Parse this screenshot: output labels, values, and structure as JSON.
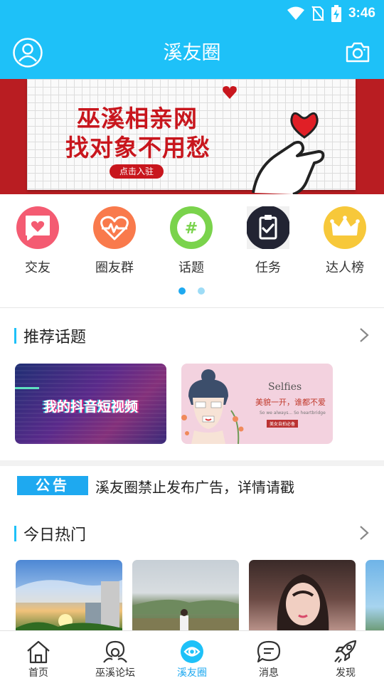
{
  "status_bar": {
    "time": "3:46"
  },
  "header": {
    "title": "溪友圈"
  },
  "banner": {
    "line1": "巫溪相亲网",
    "line2": "找对象不用愁",
    "cta": "点击入驻"
  },
  "quick_menu": [
    {
      "label": "交友",
      "icon": "heart-chat-icon",
      "color": "#f45b72"
    },
    {
      "label": "圈友群",
      "icon": "heartbeat-icon",
      "color": "#f97a4c"
    },
    {
      "label": "话题",
      "icon": "hashtag-icon",
      "color": "#7ad34c"
    },
    {
      "label": "任务",
      "icon": "clipboard-check-icon",
      "color": "#222433"
    },
    {
      "label": "达人榜",
      "icon": "crown-icon",
      "color": "#f7c83a"
    }
  ],
  "pager": {
    "count": 2,
    "active": 0
  },
  "recommended": {
    "title": "推荐话题",
    "cards": [
      {
        "text": "我的抖音短视频"
      },
      {
        "word": "Selfies",
        "caption": "美貌一开，谁都不爱",
        "small": "So we always... So heartbridge",
        "tag": "美女自拍必备"
      }
    ]
  },
  "notice": {
    "badge": "公告",
    "text": "溪友圈禁止发布广告，详情请戳"
  },
  "hot": {
    "title": "今日热门"
  },
  "tabs": [
    {
      "label": "首页",
      "icon": "home-icon"
    },
    {
      "label": "巫溪论坛",
      "icon": "forum-icon"
    },
    {
      "label": "溪友圈",
      "icon": "circle-eye-icon",
      "active": true
    },
    {
      "label": "消息",
      "icon": "message-icon"
    },
    {
      "label": "发现",
      "icon": "rocket-icon"
    }
  ],
  "colors": {
    "brand": "#1ec1f8",
    "accent": "#1ea9f0",
    "banner_red": "#c8161d"
  }
}
